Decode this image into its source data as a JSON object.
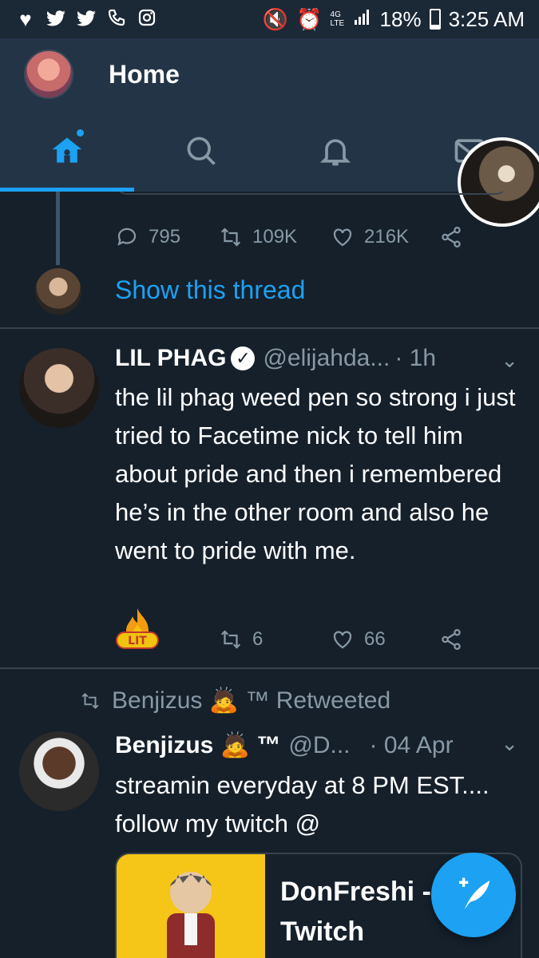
{
  "status_bar": {
    "left_icons": [
      "heart-icon",
      "twitter-icon",
      "twitter-icon",
      "phone-icon",
      "instagram-icon"
    ],
    "battery": "18%",
    "time": "3:25 AM",
    "lte": "4G LTE"
  },
  "header": {
    "title": "Home"
  },
  "tabs": [
    {
      "name": "home",
      "icon": "home-icon",
      "active": true
    },
    {
      "name": "search",
      "icon": "search-icon",
      "active": false
    },
    {
      "name": "notifications",
      "icon": "bell-icon",
      "active": false
    },
    {
      "name": "messages",
      "icon": "mail-icon",
      "active": false
    }
  ],
  "prev_tweet": {
    "replies": "795",
    "retweets": "109K",
    "likes": "216K",
    "show_thread": "Show this thread"
  },
  "tweet1": {
    "name": "LIL PHAG",
    "handle": "@elijahda...",
    "time": "· 1h",
    "text": "the lil phag weed pen so strong i just tried to Facetime nick to tell him about pride and then i remembered he’s in the other room and also he went to pride with me.",
    "lit_label": "LIT",
    "retweets": "6",
    "likes": "66"
  },
  "tweet2": {
    "retweeted_by": "Benjizus 🙇 ™ Retweeted",
    "name": "Benjizus 🙇 ™",
    "handle": "@D...",
    "time": "· 04 Apr",
    "text": "streamin everyday at 8 PM EST.... follow my twitch @",
    "card_title": "DonFreshi - Twitch"
  },
  "colors": {
    "accent": "#1da1f2",
    "background": "#15202b",
    "header": "#243447",
    "muted": "#8899a6"
  }
}
